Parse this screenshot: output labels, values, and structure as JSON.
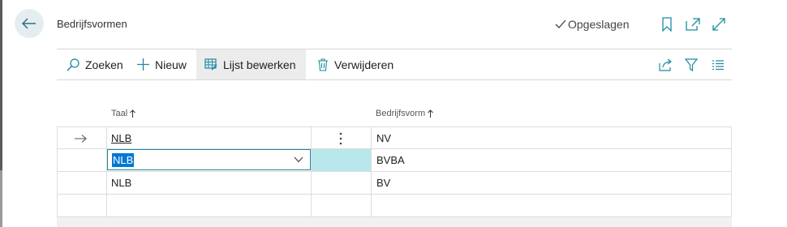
{
  "header": {
    "title": "Bedrijfsvormen",
    "status": "Opgeslagen"
  },
  "actions": {
    "search": "Zoeken",
    "new": "Nieuw",
    "edit_list": "Lijst bewerken",
    "delete": "Verwijderen"
  },
  "columns": {
    "language": "Taal",
    "company_form": "Bedrijfsvorm"
  },
  "rows": [
    {
      "language": "NLB",
      "company_form": "NV"
    },
    {
      "language": "NLB",
      "company_form": "BVBA"
    },
    {
      "language": "NLB",
      "company_form": "BV"
    }
  ],
  "colors": {
    "accent": "#1c8aa0",
    "selection": "#0078d4",
    "active_cell": "#b8e8ec"
  }
}
